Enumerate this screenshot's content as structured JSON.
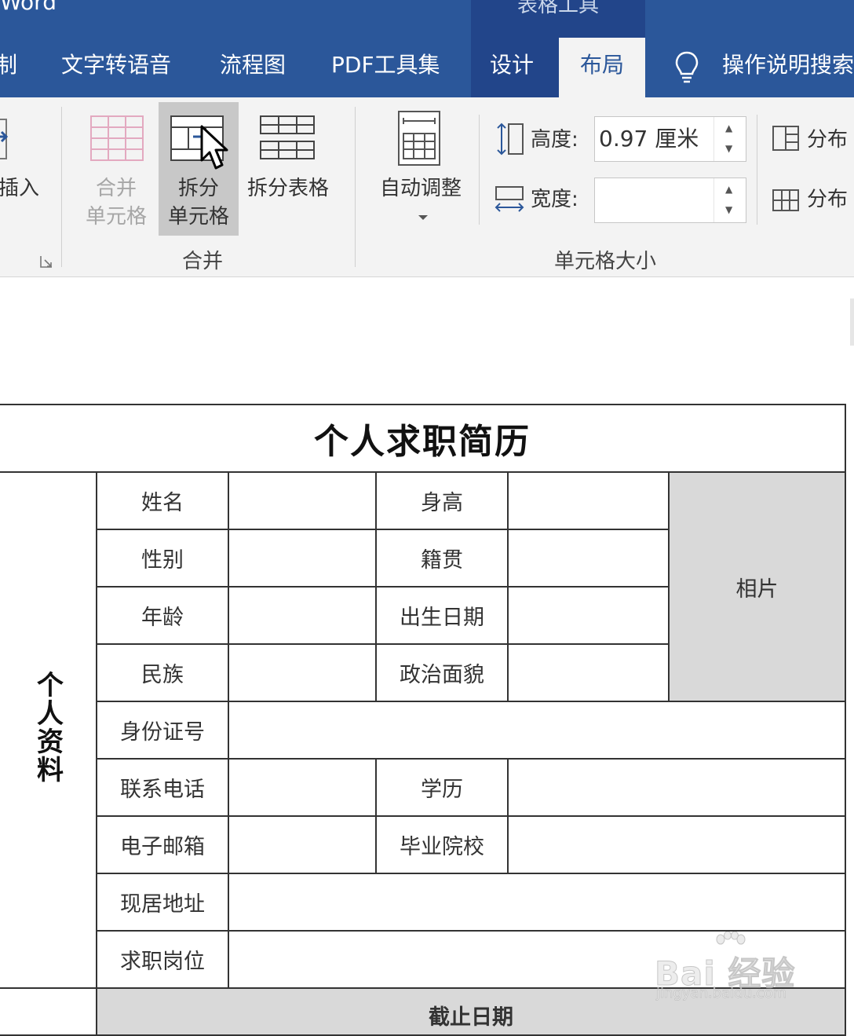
{
  "app": {
    "title": "Word",
    "context_group": "表格工具"
  },
  "tabs": [
    {
      "label": "制"
    },
    {
      "label": "文字转语音"
    },
    {
      "label": "流程图"
    },
    {
      "label": "PDF工具集"
    },
    {
      "label": "设计"
    },
    {
      "label": "布局",
      "active": true
    },
    {
      "label": "操作说明搜索"
    }
  ],
  "ribbon": {
    "insert": {
      "label": "插入"
    },
    "merge_group": {
      "label": "合并",
      "merge_cells": {
        "line1": "合并",
        "line2": "单元格",
        "disabled": true
      },
      "split_cells": {
        "line1": "拆分",
        "line2": "单元格",
        "highlighted": true
      },
      "split_table": {
        "label": "拆分表格"
      }
    },
    "autofit": {
      "label": "自动调整"
    },
    "cell_size_group": {
      "label": "单元格大小",
      "height": {
        "label": "高度:",
        "value": "0.97 厘米"
      },
      "width": {
        "label": "宽度:",
        "value": ""
      }
    },
    "distribute": {
      "rows": "分布",
      "cols": "分布"
    }
  },
  "document": {
    "title": "个人求职简历",
    "section_label": "个人资料",
    "photo_label": "相片",
    "fields": {
      "name": "姓名",
      "height": "身高",
      "gender": "性别",
      "hometown": "籍贯",
      "age": "年龄",
      "birth_date": "出生日期",
      "ethnicity": "民族",
      "political_status": "政治面貌",
      "id_number": "身份证号",
      "phone": "联系电话",
      "education": "学历",
      "email": "电子邮箱",
      "school": "毕业院校",
      "address": "现居地址",
      "job": "求职岗位",
      "deadline": "截止日期"
    }
  },
  "watermark": {
    "text": "Bai 经验",
    "url": "jingyan.baidu.com"
  },
  "colors": {
    "word_blue": "#2b579a",
    "context_blue": "#22458a",
    "ribbon_bg": "#f3f3f3",
    "photo_gray": "#d9d9d9"
  }
}
